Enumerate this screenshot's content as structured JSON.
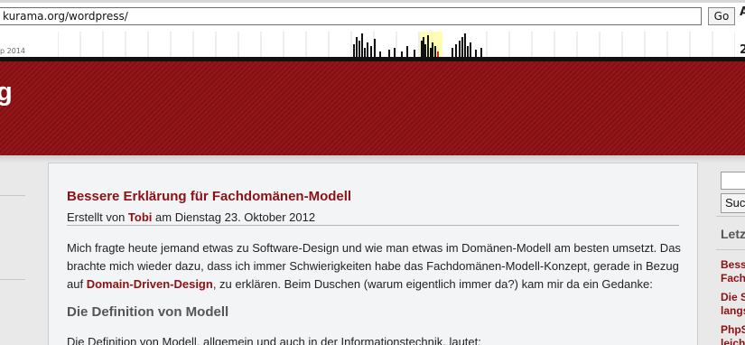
{
  "toolbar": {
    "url": "kurama.org/wordpress/",
    "go_label": "Go",
    "right_letter": "A",
    "date_fragment": "p 2014",
    "right_number": "2"
  },
  "header": {
    "title_fragment": "g"
  },
  "post": {
    "title": "Bessere Erklärung für Fachdomänen-Modell",
    "byline_prefix": "Erstellt von ",
    "author": "Tobi",
    "byline_suffix": " am Dienstag 23. Oktober 2012",
    "para_line1": "Mich fragte heute jemand etwas zu Software-Design und wie man etwas im Domänen-Modell am besten umsetzt. Das",
    "para_line2": "brachte mich wieder dazu, dass ich immer Schwierigkeiten habe das Fachdomänen-Modell-Konzept, gerade in Bezug",
    "para_line3_prefix": "auf ",
    "para_link": "Domain-Driven-Design",
    "para_line3_suffix": ", zu erklären. Beim Duschen (warum eigentlich immer da?) kam mir da ein Gedanke:",
    "section_heading": "Die Definition von Modell",
    "para2": "Die Definition von Modell, allgemein und auch in der Informationstechnik, lautet:"
  },
  "sidebar": {
    "search_button": "Suchen",
    "recent_heading": "Letzte",
    "links": [
      [
        "Bess",
        "Fach"
      ],
      [
        "Die S",
        "langs"
      ],
      [
        "PhpS",
        "leich"
      ]
    ]
  },
  "colors": {
    "brand": "#8c0f12",
    "link": "#8c1114"
  }
}
